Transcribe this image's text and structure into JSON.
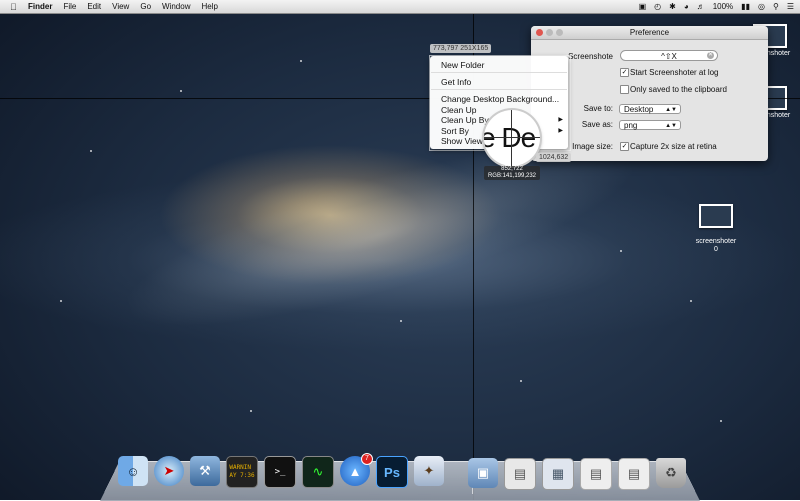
{
  "menubar": {
    "app_name": "Finder",
    "items": [
      "File",
      "Edit",
      "View",
      "Go",
      "Window",
      "Help"
    ],
    "battery": "100%",
    "status_icons": [
      "camera-icon",
      "time-machine-icon",
      "bluetooth-icon",
      "wifi-icon",
      "volume-icon",
      "battery-icon",
      "screenshot-icon",
      "search-icon",
      "list-icon"
    ]
  },
  "capture": {
    "origin_label": "773,797 251X165",
    "corner_label": "1024,632",
    "magnifier_text": "e De",
    "magnifier_coords": "852,722",
    "magnifier_rgb": "RGB:141,199,232"
  },
  "context_menu": {
    "items": [
      "New Folder",
      "Get Info",
      "Change Desktop Background...",
      "Clean Up",
      "Clean Up By",
      "Sort By",
      "Show View"
    ]
  },
  "preference": {
    "title": "Preference",
    "hotkey_label": "Screenshote",
    "hotkey_value": "^⇧X",
    "start_at_login": "Start Screenshoter at log",
    "only_clipboard": "Only saved to the clipboard",
    "save_to_label": "Save to:",
    "save_to_value": "Desktop",
    "save_as_label": "Save as:",
    "save_as_value": "png",
    "image_size_label": "Image size:",
    "retina_label": "Capture 2x size at retina",
    "start_at_login_checked": true,
    "only_clipboard_checked": false,
    "retina_checked": true
  },
  "desktop_files": [
    {
      "label": "screenshoter"
    },
    {
      "label": "screenshoter"
    },
    {
      "label": "screenshoter\n0"
    }
  ],
  "dock": {
    "apps": [
      "Finder",
      "Safari",
      "Xcode",
      "Console",
      "Terminal",
      "Activity Monitor",
      "App Store",
      "Photoshop",
      "Mail"
    ],
    "console_text": "WARNIN\nAY 7:36",
    "terminal_text": ">_",
    "photoshop_text": "Ps",
    "app_store_badge": "7"
  }
}
